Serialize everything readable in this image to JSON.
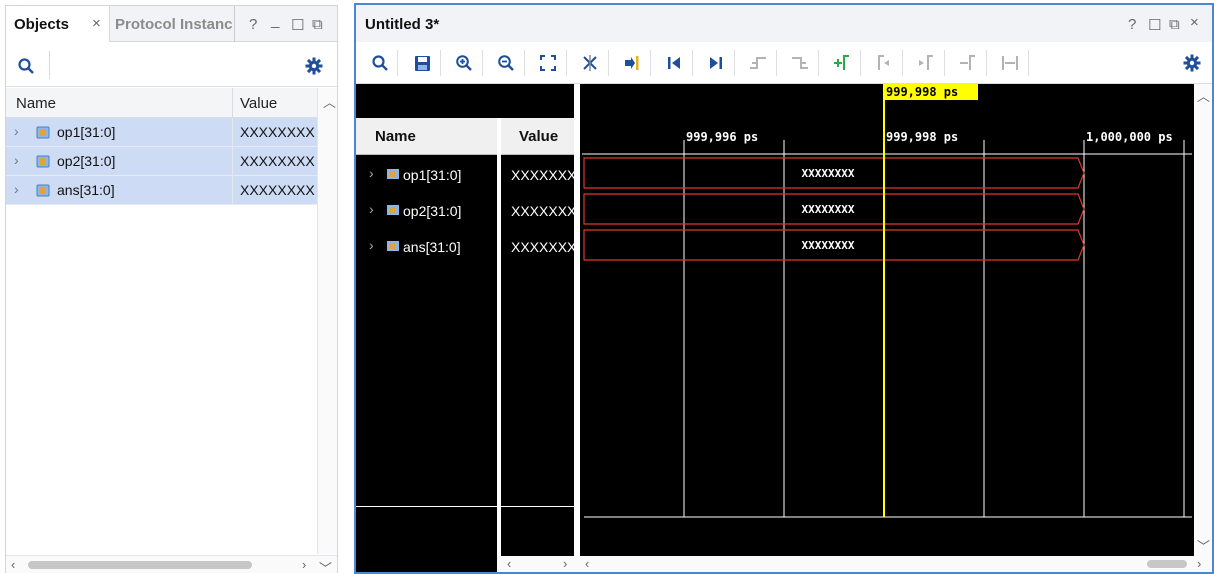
{
  "left_panel": {
    "tabs": [
      {
        "label": "Objects",
        "close": "×"
      },
      {
        "label": "Protocol Instanc"
      }
    ],
    "window_controls": [
      "?",
      "_",
      "☐",
      "⧉"
    ],
    "toolbar": {
      "icons": [
        "search-icon",
        "settings-icon"
      ]
    },
    "table": {
      "columns": [
        "Name",
        "Value"
      ],
      "rows": [
        {
          "name": "op1[31:0]",
          "value": "XXXXXXXX"
        },
        {
          "name": "op2[31:0]",
          "value": "XXXXXXXX"
        },
        {
          "name": "ans[31:0]",
          "value": "XXXXXXXX"
        }
      ]
    }
  },
  "wave_window": {
    "title": "Untitled 3*",
    "window_controls": [
      "?",
      "☐",
      "⧉",
      "×"
    ],
    "toolbar_icons": [
      "search-icon",
      "save-icon",
      "zoom-in-icon",
      "zoom-out-icon",
      "zoom-fit-icon",
      "swap-cursor-icon",
      "go-to-cursor-icon",
      "go-to-time-zero-icon",
      "go-to-last-time-icon",
      "previous-transition-icon",
      "next-transition-icon",
      "add-marker-icon",
      "previous-marker-icon",
      "next-marker-icon",
      "delete-marker-icon",
      "swap-markers-icon",
      "settings-icon"
    ],
    "columns": {
      "name": "Name",
      "value": "Value"
    },
    "signals": [
      {
        "name": "op1[31:0]",
        "value": "XXXXXXXX",
        "wave_label": "XXXXXXXX"
      },
      {
        "name": "op2[31:0]",
        "value": "XXXXXXXX",
        "wave_label": "XXXXXXXX"
      },
      {
        "name": "ans[31:0]",
        "value": "XXXXXXXX",
        "wave_label": "XXXXXXXX"
      }
    ],
    "timeline": {
      "ticks": [
        "999,996 ps",
        "999,998 ps",
        "1,000,000 ps"
      ],
      "cursor_label": "999,998 ps",
      "unknown_color": "#e0362c",
      "cursor_color": "#ffff00",
      "background": "#000000"
    }
  }
}
